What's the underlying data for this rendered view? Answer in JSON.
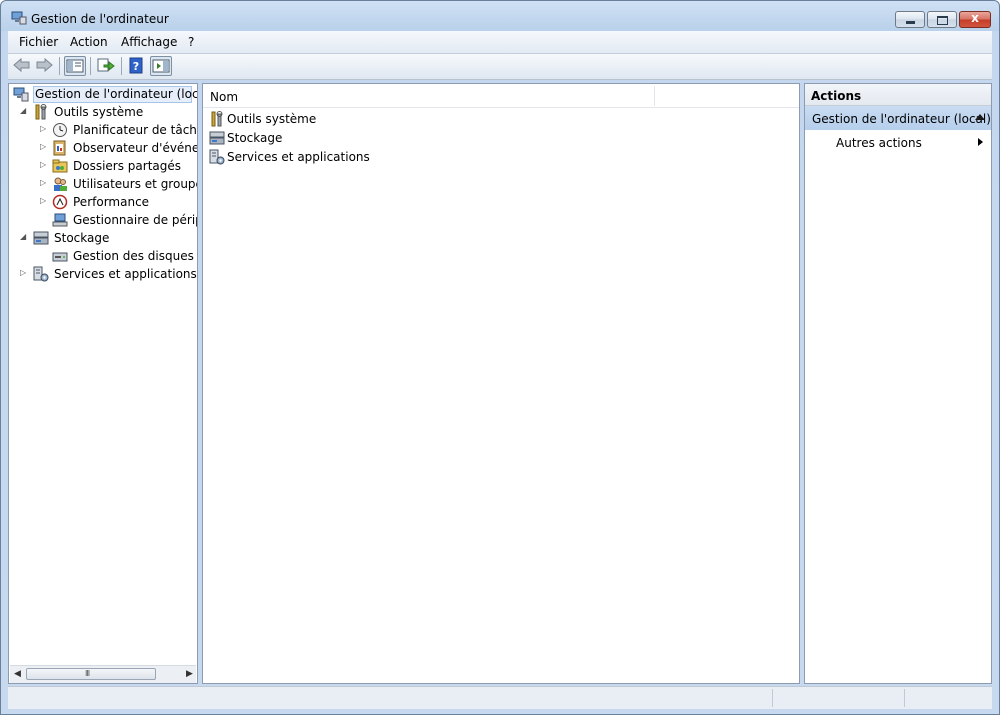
{
  "window": {
    "title": "Gestion de l'ordinateur",
    "close_glyph": "x"
  },
  "menu": [
    "Fichier",
    "Action",
    "Affichage",
    "?"
  ],
  "toolbar": {
    "icons": [
      "back-arrow-icon",
      "forward-arrow-icon",
      "show-hide-tree-icon",
      "export-list-icon",
      "help-icon",
      "show-hide-action-pane-icon"
    ]
  },
  "tree": {
    "root": "Gestion de l'ordinateur (local)",
    "items": [
      {
        "label": "Outils système",
        "icon": "tools-icon",
        "level": 1,
        "expander": "open"
      },
      {
        "label": "Planificateur de tâches",
        "icon": "clock-icon",
        "level": 2,
        "expander": "closed"
      },
      {
        "label": "Observateur d'événeme",
        "icon": "event-viewer-icon",
        "level": 2,
        "expander": "closed"
      },
      {
        "label": "Dossiers partagés",
        "icon": "shared-folder-icon",
        "level": 2,
        "expander": "closed"
      },
      {
        "label": "Utilisateurs et groupes l",
        "icon": "users-icon",
        "level": 2,
        "expander": "closed"
      },
      {
        "label": "Performance",
        "icon": "performance-icon",
        "level": 2,
        "expander": "closed"
      },
      {
        "label": "Gestionnaire de périphé",
        "icon": "device-manager-icon",
        "level": 2,
        "expander": "none"
      },
      {
        "label": "Stockage",
        "icon": "storage-icon",
        "level": 1,
        "expander": "open"
      },
      {
        "label": "Gestion des disques",
        "icon": "disk-icon",
        "level": 2,
        "expander": "none"
      },
      {
        "label": "Services et applications",
        "icon": "services-icon",
        "level": 1,
        "expander": "closed"
      }
    ],
    "scrollbar_grip": "III"
  },
  "list": {
    "column": "Nom",
    "items": [
      {
        "label": "Outils système",
        "icon": "tools-icon"
      },
      {
        "label": "Stockage",
        "icon": "storage-icon"
      },
      {
        "label": "Services et applications",
        "icon": "services-icon"
      }
    ]
  },
  "actions": {
    "header": "Actions",
    "section": "Gestion de l'ordinateur (local)",
    "item": "Autres actions"
  },
  "colors": {
    "selection": "#e5eef9",
    "actions_section": "#c0d6f0",
    "frame": "#c4d7ee"
  }
}
